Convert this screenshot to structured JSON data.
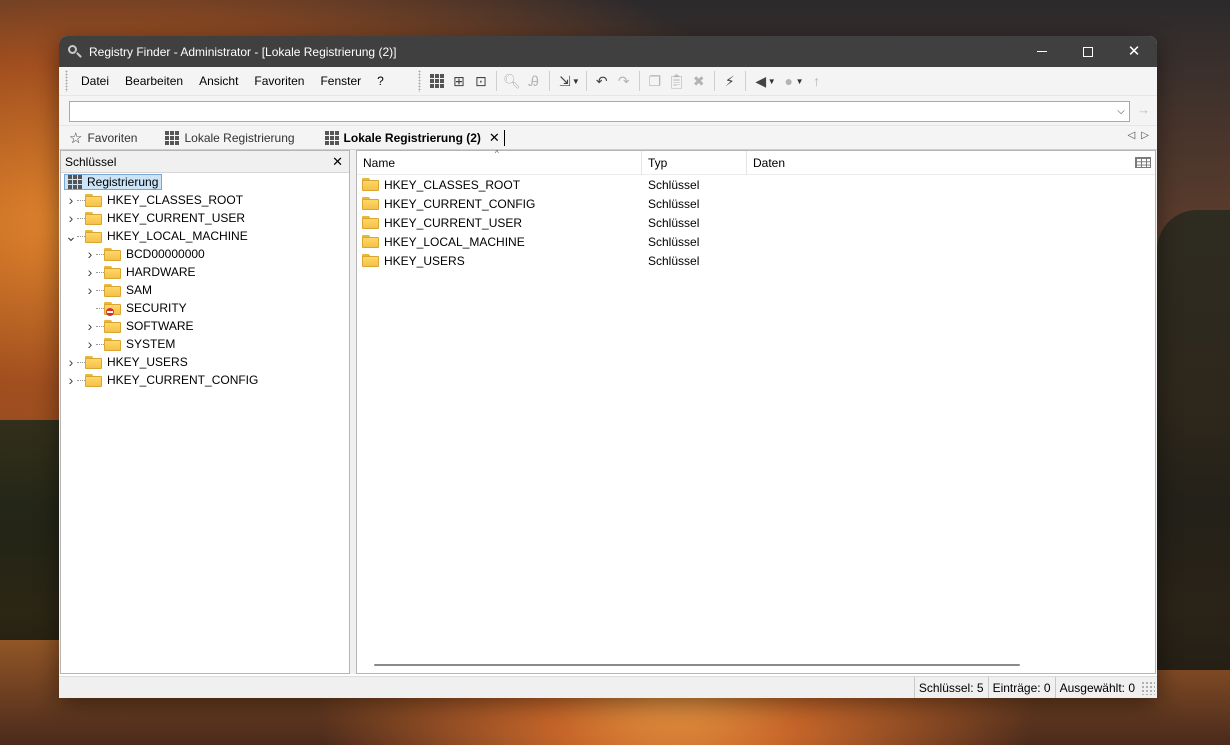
{
  "window": {
    "title": "Registry Finder - Administrator - [Lokale Registrierung (2)]"
  },
  "menu": [
    "Datei",
    "Bearbeiten",
    "Ansicht",
    "Favoriten",
    "Fenster",
    "?"
  ],
  "address": {
    "value": ""
  },
  "tabs": [
    {
      "label": "Favoriten",
      "icon": "star-icon",
      "active": false
    },
    {
      "label": "Lokale Registrierung",
      "icon": "registry-grid-icon",
      "active": false
    },
    {
      "label": "Lokale Registrierung (2)",
      "icon": "registry-grid-icon",
      "active": true
    }
  ],
  "tree_panel": {
    "header": "Schlüssel",
    "root": "Registrierung",
    "items": [
      {
        "label": "HKEY_CLASSES_ROOT",
        "level": 1,
        "expander": "collapsed"
      },
      {
        "label": "HKEY_CURRENT_USER",
        "level": 1,
        "expander": "collapsed"
      },
      {
        "label": "HKEY_LOCAL_MACHINE",
        "level": 1,
        "expander": "expanded"
      },
      {
        "label": "BCD00000000",
        "level": 2,
        "expander": "collapsed"
      },
      {
        "label": "HARDWARE",
        "level": 2,
        "expander": "collapsed"
      },
      {
        "label": "SAM",
        "level": 2,
        "expander": "collapsed"
      },
      {
        "label": "SECURITY",
        "level": 2,
        "expander": "none",
        "access_denied": true
      },
      {
        "label": "SOFTWARE",
        "level": 2,
        "expander": "collapsed"
      },
      {
        "label": "SYSTEM",
        "level": 2,
        "expander": "collapsed"
      },
      {
        "label": "HKEY_USERS",
        "level": 1,
        "expander": "collapsed"
      },
      {
        "label": "HKEY_CURRENT_CONFIG",
        "level": 1,
        "expander": "collapsed"
      }
    ]
  },
  "list_panel": {
    "columns": [
      "Name",
      "Typ",
      "Daten"
    ],
    "rows": [
      {
        "name": "HKEY_CLASSES_ROOT",
        "typ": "Schlüssel",
        "daten": ""
      },
      {
        "name": "HKEY_CURRENT_CONFIG",
        "typ": "Schlüssel",
        "daten": ""
      },
      {
        "name": "HKEY_CURRENT_USER",
        "typ": "Schlüssel",
        "daten": ""
      },
      {
        "name": "HKEY_LOCAL_MACHINE",
        "typ": "Schlüssel",
        "daten": ""
      },
      {
        "name": "HKEY_USERS",
        "typ": "Schlüssel",
        "daten": ""
      }
    ]
  },
  "status": {
    "keys": "Schlüssel: 5",
    "entries": "Einträge: 0",
    "selected": "Ausgewählt: 0"
  },
  "colors": {
    "titlebar": "#404040",
    "folder": "#f4c14a",
    "selection": "#cce4f7",
    "access_denied": "#d3322a"
  }
}
